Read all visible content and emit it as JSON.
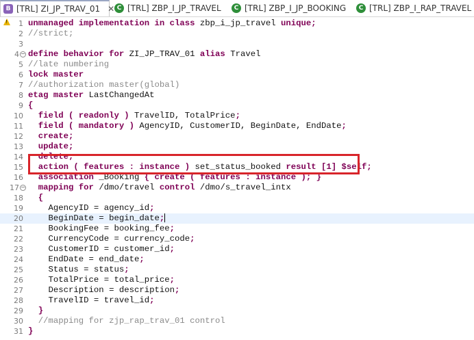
{
  "tabs": [
    {
      "label": "[TRL] ZI_JP_TRAV_01",
      "icon": "behavior-definition-icon",
      "active": true,
      "close": "✕"
    },
    {
      "label": "[TRL] ZBP_I_JP_TRAVEL",
      "icon": "class-icon",
      "active": false
    },
    {
      "label": "[TRL] ZBP_I_JP_BOOKING",
      "icon": "class-icon",
      "active": false
    },
    {
      "label": "[TRL] ZBP_I_RAP_TRAVEL",
      "icon": "class-icon",
      "active": false
    }
  ],
  "lines": [
    {
      "n": "1",
      "segs": [
        {
          "t": "unmanaged implementation in class ",
          "c": "kw"
        },
        {
          "t": "zbp_i_jp_travel ",
          "c": "tx"
        },
        {
          "t": "unique;",
          "c": "kw"
        }
      ],
      "warn": true
    },
    {
      "n": "2",
      "segs": [
        {
          "t": "//strict;",
          "c": "cm"
        }
      ]
    },
    {
      "n": "3",
      "segs": []
    },
    {
      "n": "4",
      "fold": true,
      "segs": [
        {
          "t": "define behavior for ",
          "c": "kw"
        },
        {
          "t": "ZI_JP_TRAV_01 ",
          "c": "tx"
        },
        {
          "t": "alias ",
          "c": "kw"
        },
        {
          "t": "Travel",
          "c": "tx"
        }
      ]
    },
    {
      "n": "5",
      "segs": [
        {
          "t": "//late numbering",
          "c": "cm"
        }
      ]
    },
    {
      "n": "6",
      "segs": [
        {
          "t": "lock master",
          "c": "kw"
        }
      ]
    },
    {
      "n": "7",
      "segs": [
        {
          "t": "//authorization master(global)",
          "c": "cm"
        }
      ]
    },
    {
      "n": "8",
      "segs": [
        {
          "t": "etag master ",
          "c": "kw"
        },
        {
          "t": "LastChangedAt",
          "c": "tx"
        }
      ]
    },
    {
      "n": "9",
      "segs": [
        {
          "t": "{",
          "c": "kw"
        }
      ]
    },
    {
      "n": "10",
      "segs": [
        {
          "t": "  field ( readonly ) ",
          "c": "kw"
        },
        {
          "t": "TravelID, TotalPrice",
          "c": "tx"
        },
        {
          "t": ";",
          "c": "kw"
        }
      ]
    },
    {
      "n": "11",
      "segs": [
        {
          "t": "  field ( mandatory ) ",
          "c": "kw"
        },
        {
          "t": "AgencyID, CustomerID, BeginDate, EndDate",
          "c": "tx"
        },
        {
          "t": ";",
          "c": "kw"
        }
      ]
    },
    {
      "n": "12",
      "segs": [
        {
          "t": "  create;",
          "c": "kw"
        }
      ]
    },
    {
      "n": "13",
      "segs": [
        {
          "t": "  update;",
          "c": "kw"
        }
      ]
    },
    {
      "n": "14",
      "segs": [
        {
          "t": "  delete;",
          "c": "kw"
        }
      ]
    },
    {
      "n": "15",
      "segs": [
        {
          "t": "  action ( features : instance ) ",
          "c": "kw"
        },
        {
          "t": "set_status_booked ",
          "c": "tx"
        },
        {
          "t": "result [1] $self;",
          "c": "kw"
        }
      ]
    },
    {
      "n": "16",
      "segs": [
        {
          "t": "  association ",
          "c": "kw"
        },
        {
          "t": "_Booking ",
          "c": "tx"
        },
        {
          "t": "{ create ( features : instance ); }",
          "c": "kw"
        }
      ]
    },
    {
      "n": "17",
      "fold": true,
      "segs": [
        {
          "t": "  mapping for ",
          "c": "kw"
        },
        {
          "t": "/dmo/travel ",
          "c": "tx"
        },
        {
          "t": "control ",
          "c": "kw"
        },
        {
          "t": "/dmo/s_travel_intx",
          "c": "tx"
        }
      ]
    },
    {
      "n": "18",
      "segs": [
        {
          "t": "  {",
          "c": "kw"
        }
      ]
    },
    {
      "n": "19",
      "segs": [
        {
          "t": "    AgencyID = agency_id",
          "c": "tx"
        },
        {
          "t": ";",
          "c": "kw"
        }
      ]
    },
    {
      "n": "20",
      "current": true,
      "segs": [
        {
          "t": "    BeginDate = begin_date",
          "c": "tx"
        },
        {
          "t": ";",
          "c": "kw"
        }
      ]
    },
    {
      "n": "21",
      "segs": [
        {
          "t": "    BookingFee = booking_fee",
          "c": "tx"
        },
        {
          "t": ";",
          "c": "kw"
        }
      ]
    },
    {
      "n": "22",
      "segs": [
        {
          "t": "    CurrencyCode = currency_code",
          "c": "tx"
        },
        {
          "t": ";",
          "c": "kw"
        }
      ]
    },
    {
      "n": "23",
      "segs": [
        {
          "t": "    CustomerID = customer_id",
          "c": "tx"
        },
        {
          "t": ";",
          "c": "kw"
        }
      ]
    },
    {
      "n": "24",
      "segs": [
        {
          "t": "    EndDate = end_date",
          "c": "tx"
        },
        {
          "t": ";",
          "c": "kw"
        }
      ]
    },
    {
      "n": "25",
      "segs": [
        {
          "t": "    Status = status",
          "c": "tx"
        },
        {
          "t": ";",
          "c": "kw"
        }
      ]
    },
    {
      "n": "26",
      "segs": [
        {
          "t": "    TotalPrice = total_price",
          "c": "tx"
        },
        {
          "t": ";",
          "c": "kw"
        }
      ]
    },
    {
      "n": "27",
      "segs": [
        {
          "t": "    Description = description",
          "c": "tx"
        },
        {
          "t": ";",
          "c": "kw"
        }
      ]
    },
    {
      "n": "28",
      "segs": [
        {
          "t": "    TravelID = travel_id",
          "c": "tx"
        },
        {
          "t": ";",
          "c": "kw"
        }
      ]
    },
    {
      "n": "29",
      "segs": [
        {
          "t": "  }",
          "c": "kw"
        }
      ]
    },
    {
      "n": "30",
      "segs": [
        {
          "t": "  //mapping for zjp_rap_trav_01 control",
          "c": "cm"
        }
      ]
    },
    {
      "n": "31",
      "segs": [
        {
          "t": "}",
          "c": "kw"
        }
      ]
    }
  ],
  "colors": {
    "keyword": "#7f0055",
    "comment": "#8a8a8a",
    "highlight_box": "#d8242a",
    "current_line": "#e8f2fe"
  }
}
